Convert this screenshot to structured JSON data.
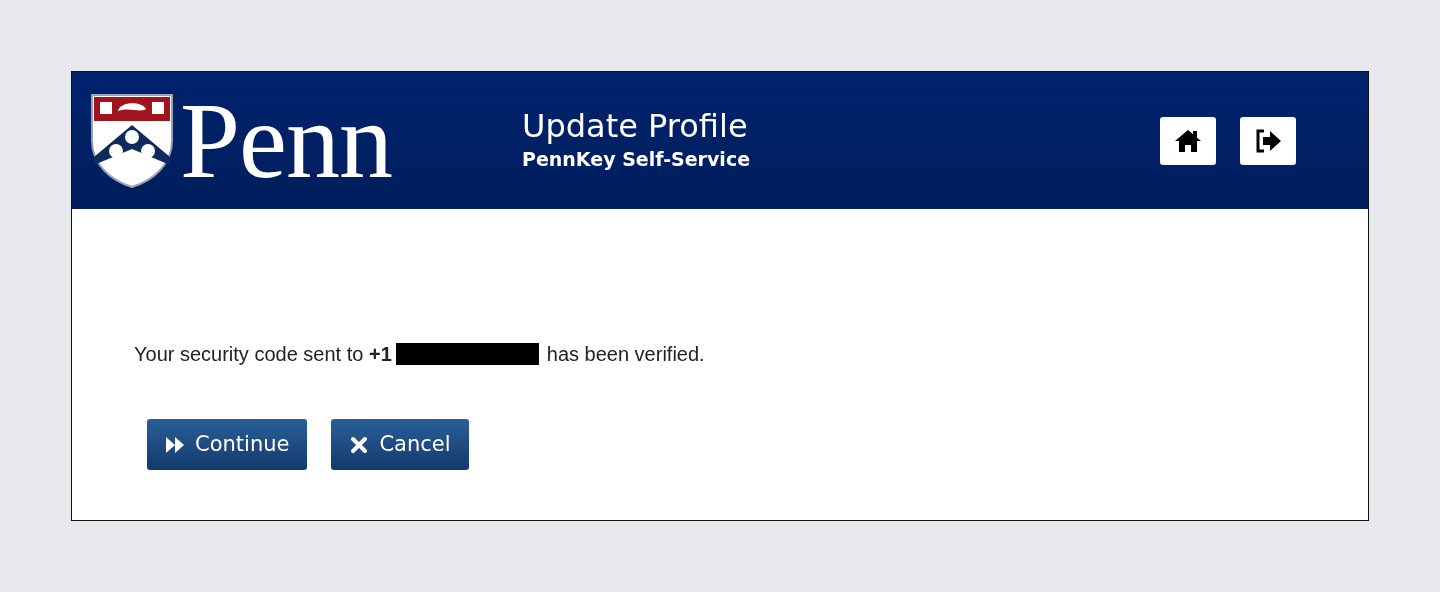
{
  "header": {
    "logo_text": "Penn",
    "title": "Update Profile",
    "subtitle": "PennKey Self-Service",
    "actions": [
      {
        "kind": "home"
      },
      {
        "kind": "logout"
      }
    ]
  },
  "message": {
    "before": "Your security code sent to **+1**",
    "redacted": true,
    "after": "has been verified."
  },
  "buttons": [
    {
      "kind": "continue",
      "label": "Continue"
    },
    {
      "kind": "cancel",
      "label": "Cancel"
    }
  ]
}
